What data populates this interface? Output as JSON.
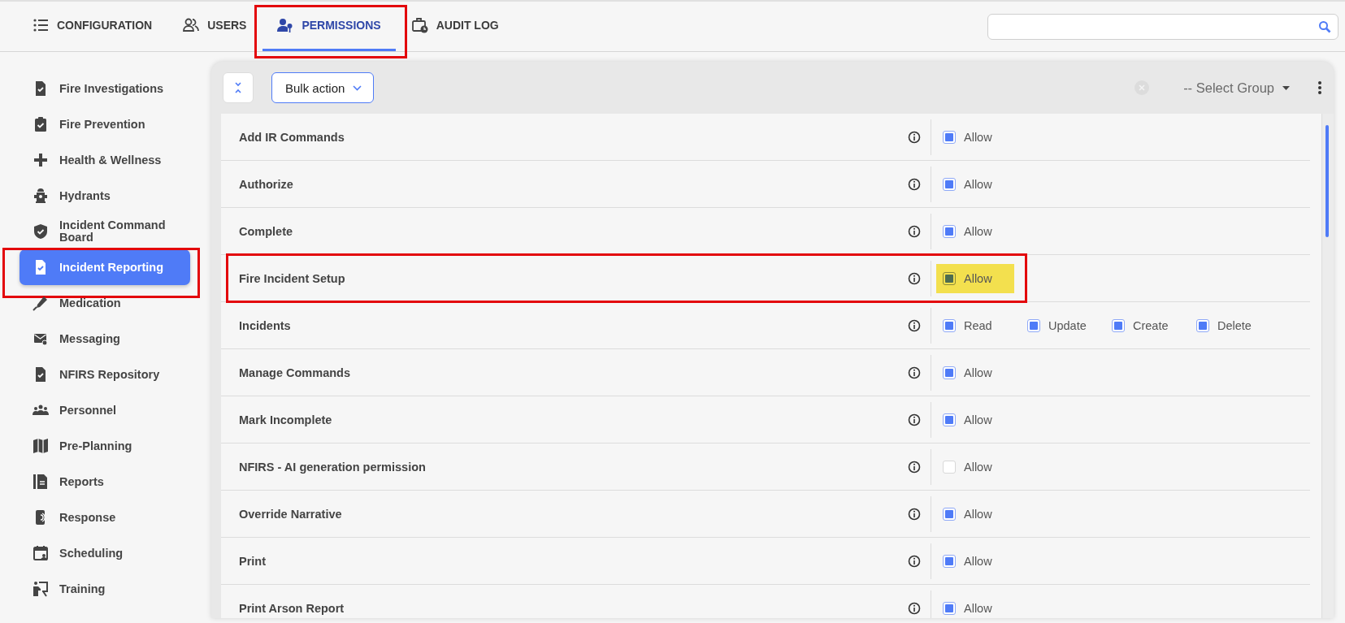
{
  "tabs": [
    {
      "label": "CONFIGURATION",
      "kind": "list",
      "selected": false,
      "annotated": false
    },
    {
      "label": "USERS",
      "kind": "users",
      "selected": false,
      "annotated": false
    },
    {
      "label": "PERMISSIONS",
      "kind": "user-key",
      "selected": true,
      "annotated": true
    },
    {
      "label": "AUDIT LOG",
      "kind": "briefcase-clock",
      "selected": false,
      "annotated": false
    }
  ],
  "sidebar": {
    "items": [
      {
        "label": "Fire Investigations",
        "kind": "doc-check",
        "selected": false,
        "annotated": false
      },
      {
        "label": "Fire Prevention",
        "kind": "clipboard-check",
        "selected": false,
        "annotated": false
      },
      {
        "label": "Health & Wellness",
        "kind": "plus",
        "selected": false,
        "annotated": false
      },
      {
        "label": "Hydrants",
        "kind": "hydrant",
        "selected": false,
        "annotated": false
      },
      {
        "label": "Incident Command Board",
        "kind": "shield-check",
        "selected": false,
        "annotated": false
      },
      {
        "label": "Incident Reporting",
        "kind": "doc-check",
        "selected": true,
        "annotated": true
      },
      {
        "label": "Medication",
        "kind": "syringe",
        "selected": false,
        "annotated": false
      },
      {
        "label": "Messaging",
        "kind": "mail",
        "selected": false,
        "annotated": false
      },
      {
        "label": "NFIRS Repository",
        "kind": "doc-check",
        "selected": false,
        "annotated": false
      },
      {
        "label": "Personnel",
        "kind": "people",
        "selected": false,
        "annotated": false
      },
      {
        "label": "Pre-Planning",
        "kind": "map",
        "selected": false,
        "annotated": false
      },
      {
        "label": "Reports",
        "kind": "report",
        "selected": false,
        "annotated": false
      },
      {
        "label": "Response",
        "kind": "phone",
        "selected": false,
        "annotated": false
      },
      {
        "label": "Scheduling",
        "kind": "calendar",
        "selected": false,
        "annotated": false
      },
      {
        "label": "Training",
        "kind": "training",
        "selected": false,
        "annotated": false
      }
    ]
  },
  "toolbar": {
    "bulk_action": "Bulk action",
    "group_select": "-- Select Group"
  },
  "permissions": [
    {
      "label": "Add IR Commands",
      "annotated": false,
      "options": [
        {
          "label": "Allow",
          "checked": true,
          "highlighted": false
        }
      ]
    },
    {
      "label": "Authorize",
      "annotated": false,
      "options": [
        {
          "label": "Allow",
          "checked": true,
          "highlighted": false
        }
      ]
    },
    {
      "label": "Complete",
      "annotated": false,
      "options": [
        {
          "label": "Allow",
          "checked": true,
          "highlighted": false
        }
      ]
    },
    {
      "label": "Fire Incident Setup",
      "annotated": true,
      "options": [
        {
          "label": "Allow",
          "checked": true,
          "highlighted": true
        }
      ]
    },
    {
      "label": "Incidents",
      "annotated": false,
      "options": [
        {
          "label": "Read",
          "checked": true,
          "highlighted": false
        },
        {
          "label": "Update",
          "checked": true,
          "highlighted": false
        },
        {
          "label": "Create",
          "checked": true,
          "highlighted": false
        },
        {
          "label": "Delete",
          "checked": true,
          "highlighted": false
        }
      ]
    },
    {
      "label": "Manage Commands",
      "annotated": false,
      "options": [
        {
          "label": "Allow",
          "checked": true,
          "highlighted": false
        }
      ]
    },
    {
      "label": "Mark Incomplete",
      "annotated": false,
      "options": [
        {
          "label": "Allow",
          "checked": true,
          "highlighted": false
        }
      ]
    },
    {
      "label": "NFIRS - AI generation permission",
      "annotated": false,
      "options": [
        {
          "label": "Allow",
          "checked": false,
          "highlighted": false
        }
      ]
    },
    {
      "label": "Override Narrative",
      "annotated": false,
      "options": [
        {
          "label": "Allow",
          "checked": true,
          "highlighted": false
        }
      ]
    },
    {
      "label": "Print",
      "annotated": false,
      "options": [
        {
          "label": "Allow",
          "checked": true,
          "highlighted": false
        }
      ]
    },
    {
      "label": "Print Arson Report",
      "annotated": false,
      "options": [
        {
          "label": "Allow",
          "checked": true,
          "highlighted": false
        }
      ]
    }
  ]
}
